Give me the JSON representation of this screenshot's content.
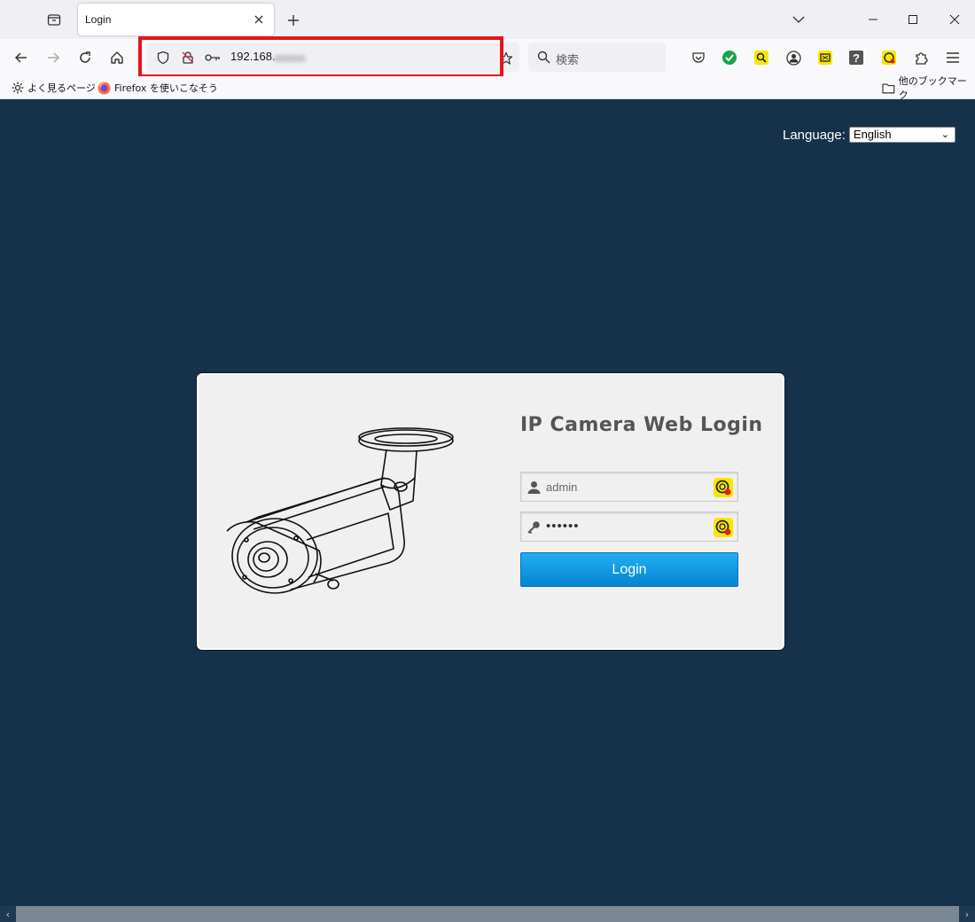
{
  "browser": {
    "tab_title": "Login",
    "url_visible": "192.168.",
    "search_placeholder": "検索",
    "bookmarks": {
      "most_visited": "よく見るページ",
      "firefox_tips": "Firefox を使いこなそう",
      "other_bookmarks": "他のブックマーク"
    },
    "highlight_color": "#e8141b"
  },
  "page": {
    "language_label": "Language:",
    "language_selected": "English",
    "title": "IP Camera Web Login",
    "username_value": "admin",
    "password_mask": "••••••",
    "login_button": "Login",
    "background_color": "#16324a",
    "accent_color": "#0a94e0"
  }
}
